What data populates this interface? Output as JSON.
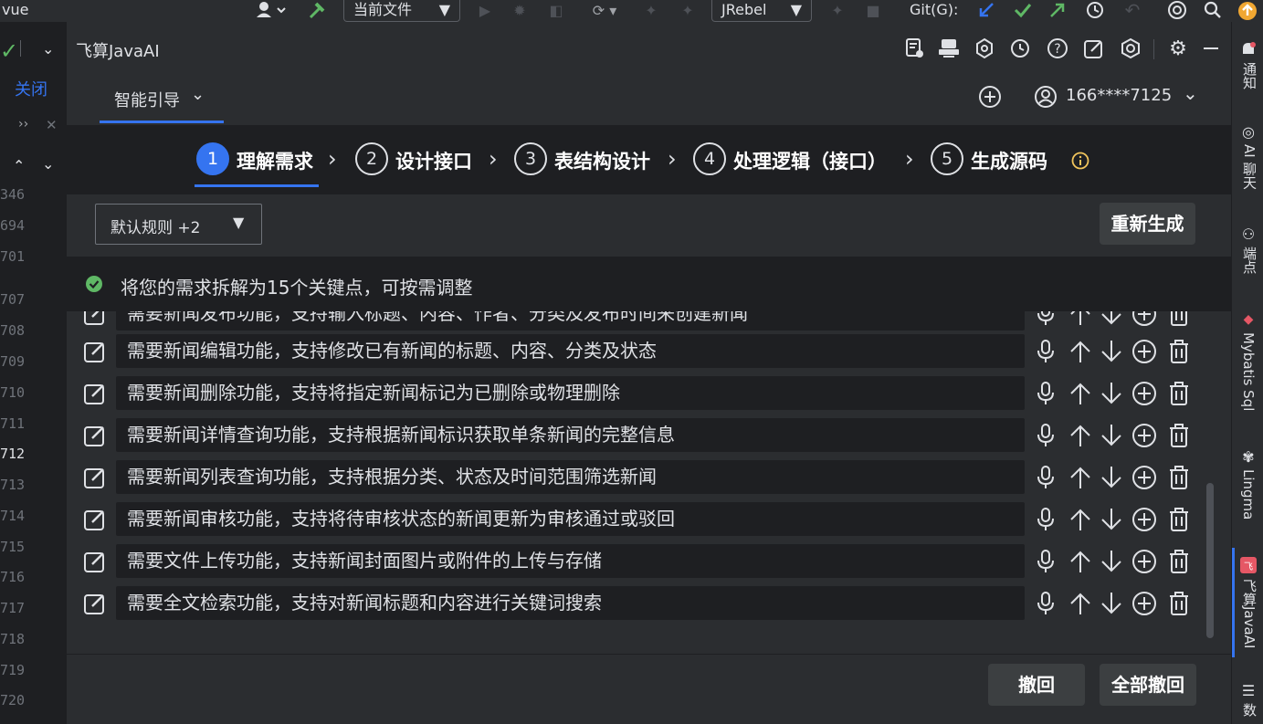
{
  "topbar": {
    "project_name": "vue",
    "current_file_label": "当前文件",
    "jrebel_label": "JRebel",
    "git_label": "Git(G):"
  },
  "left_gutter": {
    "close_label": "关闭",
    "expand_label": "››",
    "line_numbers": [
      "346",
      "694",
      "701",
      "707",
      "708",
      "709",
      "710",
      "711",
      "712",
      "713",
      "714",
      "715",
      "716",
      "717",
      "718",
      "719",
      "720"
    ]
  },
  "tool_window": {
    "title": "飞算JavaAI"
  },
  "nav": {
    "tab_label": "智能引导",
    "user_phone": "166****7125"
  },
  "steps": [
    {
      "num": "1",
      "label": "理解需求",
      "active": true
    },
    {
      "num": "2",
      "label": "设计接口",
      "active": false
    },
    {
      "num": "3",
      "label": "表结构设计",
      "active": false
    },
    {
      "num": "4",
      "label": "处理逻辑（接口）",
      "active": false
    },
    {
      "num": "5",
      "label": "生成源码",
      "active": false
    }
  ],
  "rules": {
    "select_value": "默认规则 +2",
    "regenerate_label": "重新生成"
  },
  "banner": {
    "message": "将您的需求拆解为15个关键点，可按需调整"
  },
  "requirements": [
    "需要新闻发布功能，支持输入标题、内容、作者、分类及发布时间来创建新闻",
    "需要新闻编辑功能，支持修改已有新闻的标题、内容、分类及状态",
    "需要新闻删除功能，支持将指定新闻标记为已删除或物理删除",
    "需要新闻详情查询功能，支持根据新闻标识获取单条新闻的完整信息",
    "需要新闻列表查询功能，支持根据分类、状态及时间范围筛选新闻",
    "需要新闻审核功能，支持将待审核状态的新闻更新为审核通过或驳回",
    "需要文件上传功能，支持新闻封面图片或附件的上传与存储",
    "需要全文检索功能，支持对新闻标题和内容进行关键词搜索"
  ],
  "footer": {
    "undo_label": "撤回",
    "undo_all_label": "全部撤回"
  },
  "right_sidebar": {
    "items": [
      "通知",
      "AI 聊天",
      "端点",
      "Mybatis Sql",
      "Lingma",
      "飞算JavaAI",
      "数"
    ]
  },
  "colors": {
    "accent_blue": "#3574f0",
    "success_green": "#5fb865",
    "warning_yellow": "#f2c55c",
    "panel_bg": "#2b2d30",
    "field_bg": "#1e1f22"
  }
}
